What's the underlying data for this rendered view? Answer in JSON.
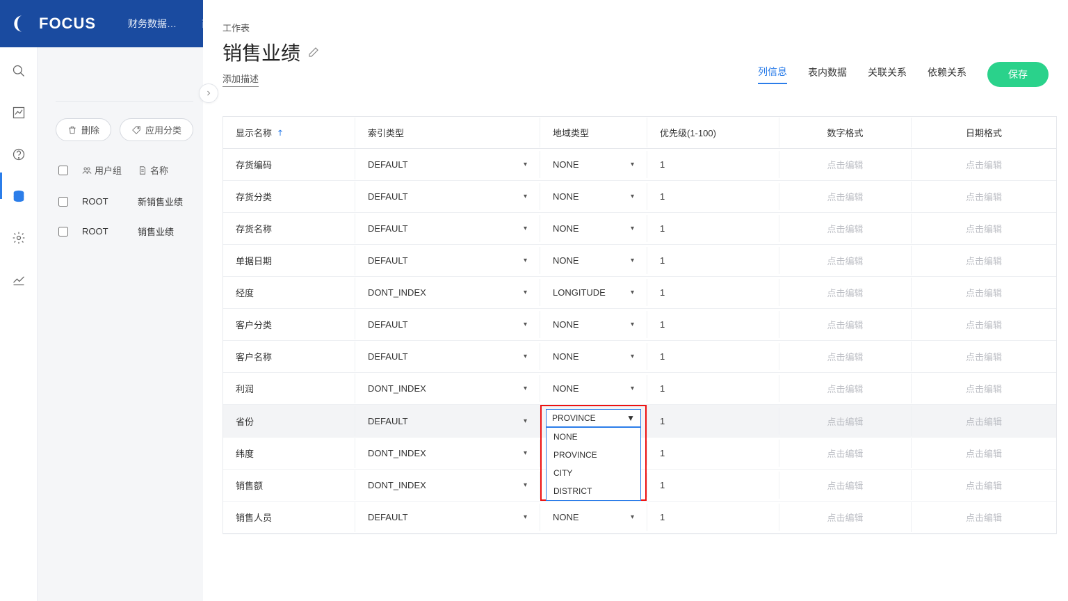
{
  "brand": "FOCUS",
  "topnav": {
    "items": [
      "财务数据…",
      "商"
    ]
  },
  "leftpanel": {
    "delete_label": "删除",
    "apply_category_label": "应用分类",
    "col_group": "用户组",
    "col_name": "名称",
    "rows": [
      {
        "group": "ROOT",
        "name": "新销售业绩"
      },
      {
        "group": "ROOT",
        "name": "销售业绩"
      }
    ]
  },
  "main": {
    "crumb": "工作表",
    "title": "销售业绩",
    "add_desc": "添加描述",
    "tabs": [
      "列信息",
      "表内数据",
      "关联关系",
      "依赖关系"
    ],
    "active_tab": 0,
    "save": "保存"
  },
  "grid": {
    "headers": {
      "display_name": "显示名称",
      "index_type": "索引类型",
      "geo_type": "地域类型",
      "priority": "优先级(1-100)",
      "num_format": "数字格式",
      "date_format": "日期格式"
    },
    "placeholder": "点击编辑",
    "rows": [
      {
        "name": "存货编码",
        "index": "DEFAULT",
        "geo": "NONE",
        "pri": "1"
      },
      {
        "name": "存货分类",
        "index": "DEFAULT",
        "geo": "NONE",
        "pri": "1"
      },
      {
        "name": "存货名称",
        "index": "DEFAULT",
        "geo": "NONE",
        "pri": "1"
      },
      {
        "name": "单据日期",
        "index": "DEFAULT",
        "geo": "NONE",
        "pri": "1"
      },
      {
        "name": "经度",
        "index": "DONT_INDEX",
        "geo": "LONGITUDE",
        "pri": "1"
      },
      {
        "name": "客户分类",
        "index": "DEFAULT",
        "geo": "NONE",
        "pri": "1"
      },
      {
        "name": "客户名称",
        "index": "DEFAULT",
        "geo": "NONE",
        "pri": "1"
      },
      {
        "name": "利润",
        "index": "DONT_INDEX",
        "geo": "NONE",
        "pri": "1"
      },
      {
        "name": "省份",
        "index": "DEFAULT",
        "geo": "PROVINCE",
        "pri": "1",
        "hl": true,
        "geo_open": true
      },
      {
        "name": "纬度",
        "index": "DONT_INDEX",
        "geo": "",
        "pri": "1"
      },
      {
        "name": "销售额",
        "index": "DONT_INDEX",
        "geo": "",
        "pri": "1"
      },
      {
        "name": "销售人员",
        "index": "DEFAULT",
        "geo": "NONE",
        "pri": "1"
      }
    ],
    "geo_options": [
      "NONE",
      "PROVINCE",
      "CITY",
      "DISTRICT"
    ]
  }
}
